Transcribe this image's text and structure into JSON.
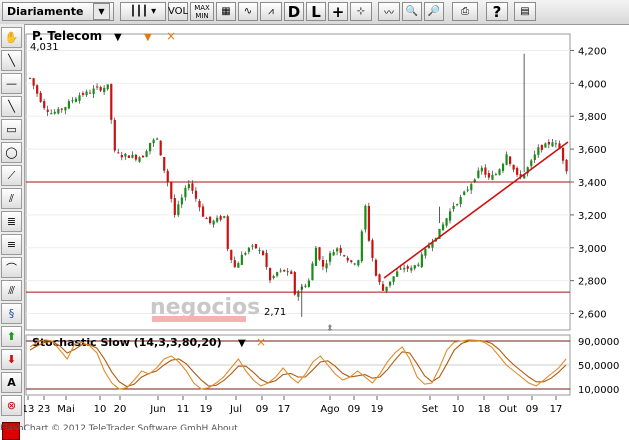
{
  "toolbar": {
    "period": "Diariamente",
    "vol_label": "VOL",
    "maxmin_line1": "MAX",
    "maxmin_line2": "MIN",
    "d_label": "D",
    "l_label": "L",
    "help_label": "?"
  },
  "chart_title": "P. Telecom",
  "price_chart": {
    "start_label": "4,031",
    "low_label": "2,71",
    "watermark": "negocios",
    "yticks": [
      "4,200",
      "4,000",
      "3,800",
      "3,600",
      "3,400",
      "3,200",
      "3,000",
      "2,800",
      "2,600"
    ]
  },
  "indicator": {
    "title": "Stochastic Slow (14,3,3,80,20)",
    "yticks": [
      "90,0000",
      "50,0000",
      "10,0000"
    ]
  },
  "xaxis_labels": [
    "13",
    "23",
    "Mai",
    "10",
    "20",
    "Jun",
    "11",
    "19",
    "Jul",
    "09",
    "17",
    "Ago",
    "09",
    "19",
    "Set",
    "10",
    "18",
    "Out",
    "09",
    "17"
  ],
  "footer": "FlashChart    © 2012 TeleTrader Software GmbH About",
  "colors": {
    "up": "#1a8c1a",
    "down": "#cc1111",
    "support": "#aa1111",
    "k": "#e07a10",
    "d": "#b05a10"
  },
  "chart_data": {
    "type": "candlestick",
    "ylim": [
      2500,
      4300
    ],
    "close_path": [
      [
        0,
        4031
      ],
      [
        2,
        3940
      ],
      [
        4,
        3860
      ],
      [
        6,
        3820
      ],
      [
        8,
        3830
      ],
      [
        10,
        3860
      ],
      [
        12,
        3900
      ],
      [
        14,
        3930
      ],
      [
        16,
        3940
      ],
      [
        18,
        3960
      ],
      [
        20,
        3970
      ],
      [
        22,
        3980
      ],
      [
        24,
        3580
      ],
      [
        26,
        3560
      ],
      [
        28,
        3560
      ],
      [
        30,
        3550
      ],
      [
        32,
        3560
      ],
      [
        34,
        3640
      ],
      [
        36,
        3660
      ],
      [
        37,
        3550
      ],
      [
        39,
        3400
      ],
      [
        41,
        3200
      ],
      [
        43,
        3300
      ],
      [
        45,
        3400
      ],
      [
        47,
        3300
      ],
      [
        49,
        3200
      ],
      [
        51,
        3150
      ],
      [
        53,
        3170
      ],
      [
        55,
        3190
      ],
      [
        56,
        3000
      ],
      [
        58,
        2880
      ],
      [
        60,
        2950
      ],
      [
        62,
        3000
      ],
      [
        64,
        3000
      ],
      [
        66,
        2960
      ],
      [
        68,
        2800
      ],
      [
        70,
        2850
      ],
      [
        72,
        2860
      ],
      [
        74,
        2830
      ],
      [
        75,
        2720
      ],
      [
        77,
        2760
      ],
      [
        79,
        2800
      ],
      [
        81,
        3000
      ],
      [
        83,
        2880
      ],
      [
        85,
        2960
      ],
      [
        87,
        3000
      ],
      [
        89,
        2960
      ],
      [
        91,
        2900
      ],
      [
        93,
        2930
      ],
      [
        95,
        3250
      ],
      [
        96,
        3050
      ],
      [
        98,
        2830
      ],
      [
        100,
        2740
      ],
      [
        102,
        2800
      ],
      [
        104,
        2850
      ],
      [
        106,
        2880
      ],
      [
        108,
        2870
      ],
      [
        110,
        2910
      ],
      [
        112,
        2980
      ],
      [
        114,
        3050
      ],
      [
        116,
        3100
      ],
      [
        118,
        3180
      ],
      [
        120,
        3260
      ],
      [
        122,
        3300
      ],
      [
        124,
        3360
      ],
      [
        126,
        3430
      ],
      [
        128,
        3480
      ],
      [
        130,
        3420
      ],
      [
        132,
        3450
      ],
      [
        134,
        3520
      ],
      [
        135,
        3580
      ],
      [
        136,
        3520
      ],
      [
        138,
        3430
      ],
      [
        140,
        3450
      ],
      [
        142,
        3520
      ],
      [
        144,
        3600
      ],
      [
        146,
        3620
      ],
      [
        148,
        3650
      ],
      [
        150,
        3600
      ],
      [
        152,
        3480
      ]
    ],
    "support_levels": [
      3400,
      2730
    ],
    "stochastic": {
      "ylim": [
        0,
        100
      ],
      "levels": [
        90,
        50,
        10
      ],
      "k": [
        80,
        88,
        92,
        90,
        75,
        60,
        85,
        88,
        82,
        70,
        40,
        20,
        10,
        12,
        25,
        40,
        35,
        45,
        60,
        65,
        55,
        40,
        20,
        10,
        12,
        20,
        30,
        45,
        60,
        40,
        25,
        15,
        20,
        30,
        45,
        30,
        20,
        35,
        55,
        65,
        50,
        35,
        25,
        30,
        40,
        30,
        20,
        35,
        55,
        70,
        80,
        60,
        30,
        18,
        20,
        45,
        75,
        88,
        90,
        92,
        91,
        88,
        80,
        65,
        50,
        40,
        30,
        20,
        15,
        25,
        35,
        45,
        60
      ],
      "d": [
        75,
        82,
        88,
        89,
        82,
        70,
        76,
        84,
        84,
        78,
        60,
        38,
        22,
        14,
        18,
        30,
        36,
        40,
        50,
        58,
        60,
        52,
        38,
        25,
        15,
        16,
        24,
        35,
        48,
        48,
        38,
        26,
        20,
        24,
        34,
        36,
        30,
        30,
        42,
        55,
        57,
        48,
        36,
        30,
        32,
        34,
        28,
        30,
        42,
        58,
        72,
        70,
        52,
        32,
        22,
        30,
        52,
        75,
        86,
        90,
        91,
        90,
        86,
        76,
        62,
        50,
        40,
        30,
        22,
        22,
        28,
        38,
        50
      ]
    }
  }
}
